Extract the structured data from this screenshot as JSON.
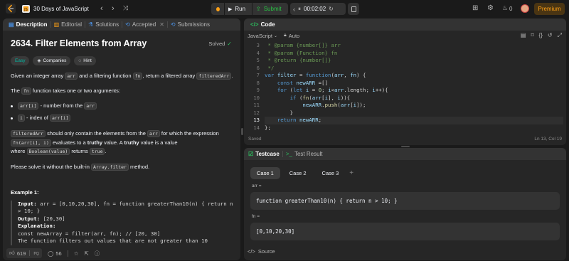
{
  "topbar": {
    "problem_list_title": "30 Days of JavaScript",
    "run_label": "Run",
    "submit_label": "Submit",
    "timer": "00:02:02",
    "streak_count": "0",
    "premium_label": "Premium"
  },
  "left": {
    "tabs": [
      {
        "label": "Description"
      },
      {
        "label": "Editorial"
      },
      {
        "label": "Solutions"
      },
      {
        "label": "Accepted"
      },
      {
        "label": "Submissions"
      }
    ],
    "title": "2634. Filter Elements from Array",
    "status": "Solved",
    "tags": {
      "difficulty": "Easy",
      "companies": "Companies",
      "hint": "Hint"
    },
    "description": {
      "p1_a": "Given an integer array ",
      "p1_code1": "arr",
      "p1_b": " and a filtering function ",
      "p1_code2": "fn",
      "p1_c": ", return a filtered array ",
      "p1_code3": "filteredArr",
      "p1_d": ".",
      "p2_code": "fn",
      "p2_text": " function takes one or two arguments:",
      "p2_pre": "The ",
      "bullet1_code": "arr[i]",
      "bullet1_text": " - number from the ",
      "bullet1_code2": "arr",
      "bullet2_code": "i",
      "bullet2_text": " - index of ",
      "bullet2_code2": "arr[i]",
      "p3_code1": "filteredArr",
      "p3_a": " should only contain the elements from the ",
      "p3_code2": "arr",
      "p3_b": " for which the expression",
      "p3_code3": "fn(arr[i], i)",
      "p3_c": " evaluates to a ",
      "p3_bold1": "truthy",
      "p3_d": " value. A ",
      "p3_bold2": "truthy",
      "p3_e": " value is a value",
      "p3_f": "where ",
      "p3_code4": "Boolean(value)",
      "p3_g": " returns ",
      "p3_code5": "true",
      "p3_h": ".",
      "p4_a": "Please solve it without the built-in ",
      "p4_code": "Array.filter",
      "p4_b": " method.",
      "example_title": "Example 1:",
      "ex_input_label": "Input:",
      "ex_input_value": " arr = [0,10,20,30], fn = function greaterThan10(n) { return n",
      "ex_input_value2": "> 10; }",
      "ex_output_label": "Output:",
      "ex_output_value": " [20,30]",
      "ex_expl_label": "Explanation:",
      "ex_expl_line1": "const newArray = filter(arr, fn); // [20, 30]",
      "ex_expl_line2": "The function filters out values that are not greater than 10"
    },
    "footer": {
      "likes": "619",
      "comments": "56"
    }
  },
  "code": {
    "tab_label": "Code",
    "language": "JavaScript",
    "mode": "Auto",
    "saved": "Saved",
    "cursor": "Ln 13, Col 19",
    "line_numbers": [
      "3",
      "4",
      "5",
      "6",
      "7",
      "8",
      "9",
      "10",
      "11",
      "12",
      "13",
      "14"
    ]
  },
  "testcase": {
    "tab_label": "Testcase",
    "result_tab_label": "Test Result",
    "cases": [
      "Case 1",
      "Case 2",
      "Case 3"
    ],
    "input1_label": "arr =",
    "input1_value": "function greaterThan10(n) { return n > 10; }",
    "input2_label": "fn =",
    "input2_value": "[0,10,20,30]",
    "source_label": "Source"
  },
  "colors": {
    "accent_green": "#2cbb5d",
    "submit_green": "#28c244",
    "premium": "#ffa116",
    "easy": "#00b8a3"
  }
}
